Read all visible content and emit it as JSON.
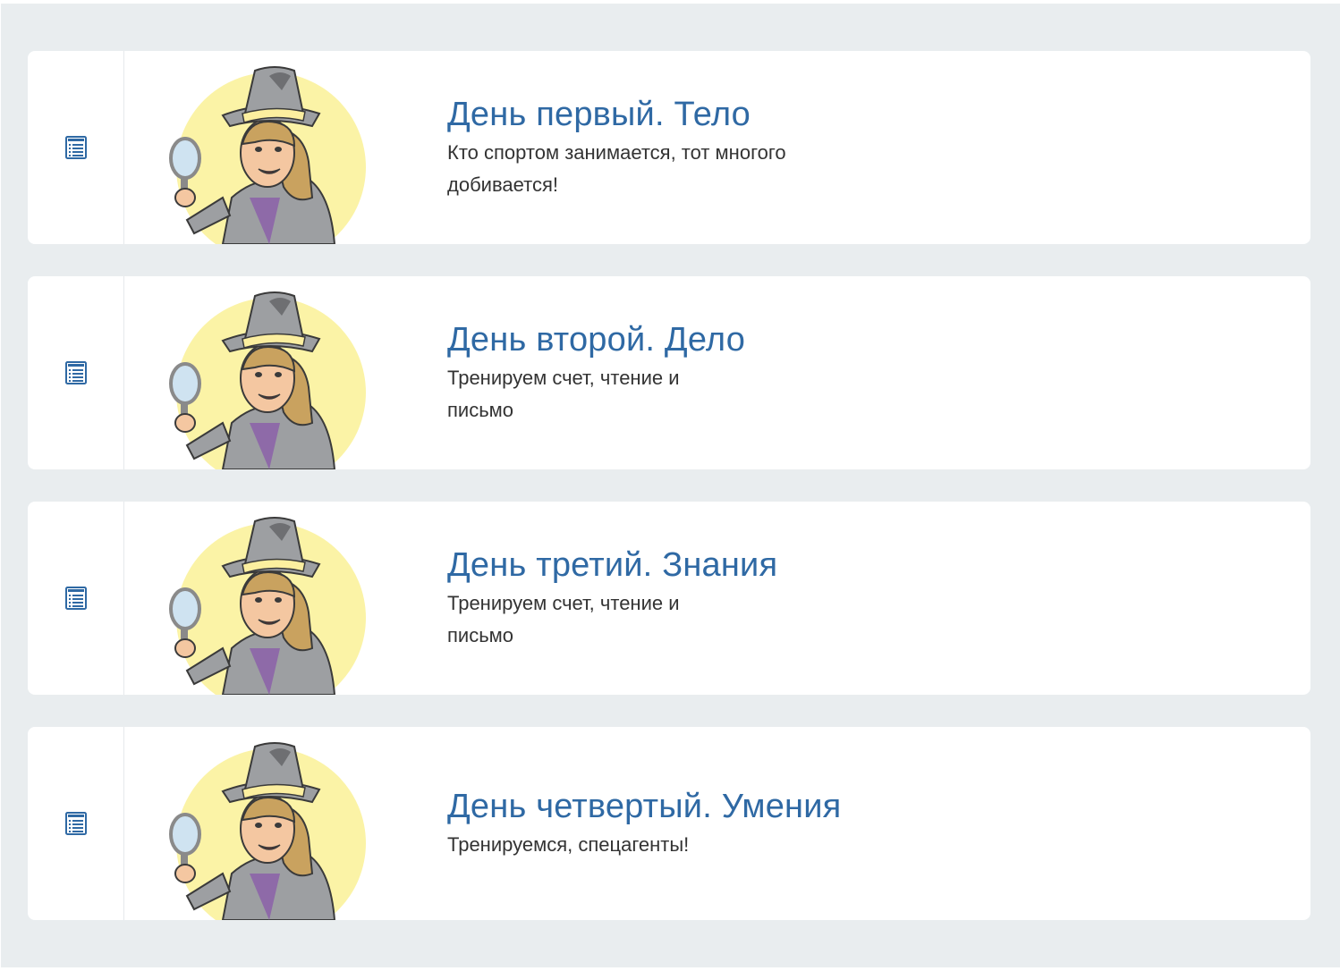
{
  "colors": {
    "page_background": "#e9edef",
    "card_background": "#ffffff",
    "title_color": "#2f69a4",
    "text_color": "#333333",
    "icon_color": "#2f69a4",
    "avatar_circle": "#fbf3a6"
  },
  "lessons": [
    {
      "icon": "list-document-icon",
      "illustration": "detective-girl-avatar",
      "title": "День первый. Тело",
      "description": "Кто спортом занимается, тот многого добивается!"
    },
    {
      "icon": "list-document-icon",
      "illustration": "detective-girl-avatar",
      "title": "День второй. Дело",
      "description": "Тренируем счет, чтение и письмо"
    },
    {
      "icon": "list-document-icon",
      "illustration": "detective-girl-avatar",
      "title": "День третий. Знания",
      "description": "Тренируем счет, чтение и письмо"
    },
    {
      "icon": "list-document-icon",
      "illustration": "detective-girl-avatar",
      "title": "День четвертый. Умения",
      "description": "Тренируемся, спецагенты!"
    }
  ]
}
